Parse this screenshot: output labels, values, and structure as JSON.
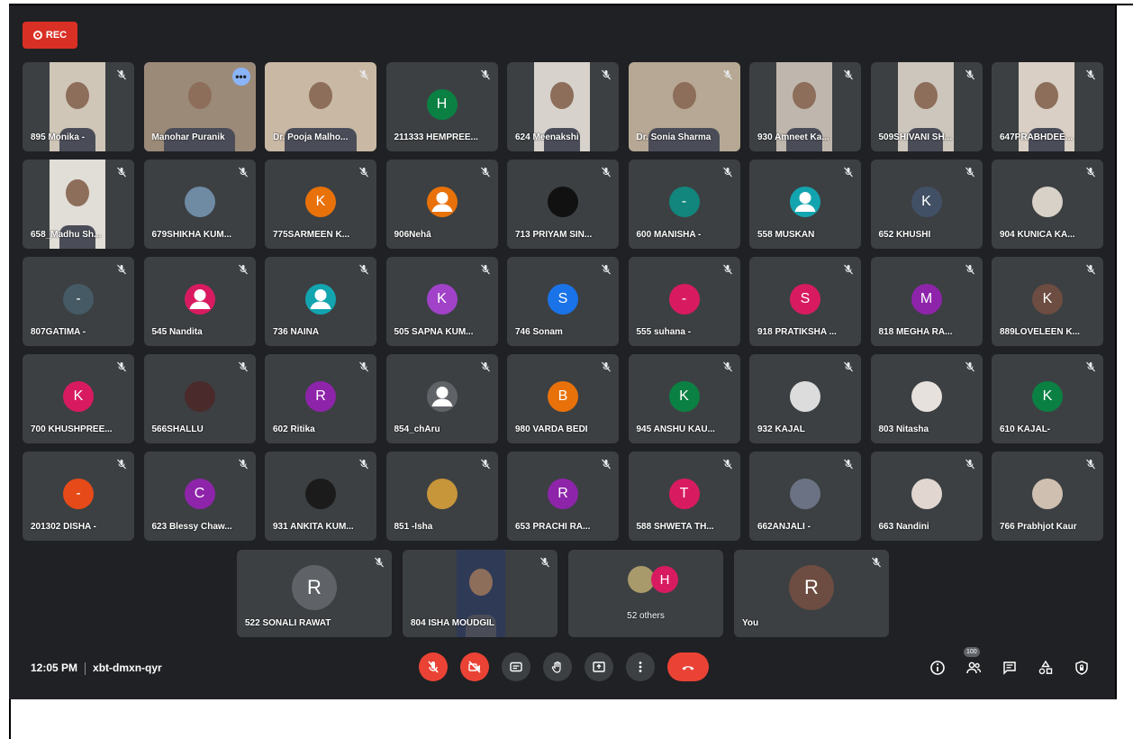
{
  "recording": {
    "label": "REC"
  },
  "participants": [
    {
      "name": "895 Monika -",
      "kind": "video",
      "bg": "#cfc6b8",
      "vx": 30,
      "vw": 62
    },
    {
      "name": "Manohar Puranik",
      "kind": "video",
      "bg": "#9c8a78",
      "vx": 0,
      "vw": 124,
      "active": true
    },
    {
      "name": "Dr. Pooja Malho...",
      "kind": "video",
      "bg": "#c9b8a4",
      "vx": 0,
      "vw": 124
    },
    {
      "name": "211333 HEMPREE...",
      "kind": "letter",
      "letter": "H",
      "color": "#0b8043"
    },
    {
      "name": "624 Meenakshi",
      "kind": "video",
      "bg": "#d7d2cc",
      "vx": 30,
      "vw": 62
    },
    {
      "name": "Dr. Sonia Sharma",
      "kind": "video",
      "bg": "#b6a894",
      "vx": 0,
      "vw": 124
    },
    {
      "name": "930 Amneet Ka...",
      "kind": "video",
      "bg": "#bfb7ad",
      "vx": 30,
      "vw": 62
    },
    {
      "name": "509SHIVANI SH...",
      "kind": "video",
      "bg": "#cdc6bc",
      "vx": 30,
      "vw": 62
    },
    {
      "name": "647PRABHDEE...",
      "kind": "video",
      "bg": "#d9cfc4",
      "vx": 30,
      "vw": 62
    },
    {
      "name": "658_Madhu Sh...",
      "kind": "video",
      "bg": "#e1ddd7",
      "vx": 30,
      "vw": 62
    },
    {
      "name": "679SHIKHA KUM...",
      "kind": "photo",
      "color": "#6f8aa3"
    },
    {
      "name": "775SARMEEN K...",
      "kind": "letter",
      "letter": "K",
      "color": "#e8710a"
    },
    {
      "name": "906Nehā",
      "kind": "person",
      "color": "#e8710a"
    },
    {
      "name": "713 PRIYAM SIN...",
      "kind": "photo",
      "color": "#111111"
    },
    {
      "name": "600 MANISHA -",
      "kind": "letter",
      "letter": "-",
      "color": "#12857c"
    },
    {
      "name": "558 MUSKAN",
      "kind": "person",
      "color": "#12a4af"
    },
    {
      "name": "652 KHUSHI",
      "kind": "letter",
      "letter": "K",
      "color": "#425066"
    },
    {
      "name": "904 KUNICA KA...",
      "kind": "photo",
      "color": "#d8d1c8"
    },
    {
      "name": "807GATIMA -",
      "kind": "letter",
      "letter": "-",
      "color": "#455a64"
    },
    {
      "name": "545 Nandita",
      "kind": "person",
      "color": "#d81b60"
    },
    {
      "name": "736 NAINA",
      "kind": "person",
      "color": "#12a4af"
    },
    {
      "name": "505 SAPNA KUM...",
      "kind": "letter",
      "letter": "K",
      "color": "#a142c8"
    },
    {
      "name": "746 Sonam",
      "kind": "letter",
      "letter": "S",
      "color": "#1a73e8"
    },
    {
      "name": "555 suhana -",
      "kind": "letter",
      "letter": "-",
      "color": "#d81b60"
    },
    {
      "name": "918 PRATIKSHA ...",
      "kind": "letter",
      "letter": "S",
      "color": "#d81b60"
    },
    {
      "name": "818 MEGHA RA...",
      "kind": "letter",
      "letter": "M",
      "color": "#8e24aa"
    },
    {
      "name": "889LOVELEEN K...",
      "kind": "letter",
      "letter": "K",
      "color": "#6d4c41"
    },
    {
      "name": "700 KHUSHPREE...",
      "kind": "letter",
      "letter": "K",
      "color": "#d81b60"
    },
    {
      "name": "566SHALLU",
      "kind": "photo",
      "color": "#4a2a2a"
    },
    {
      "name": "602 Ritika",
      "kind": "letter",
      "letter": "R",
      "color": "#8e24aa"
    },
    {
      "name": "854_chAru",
      "kind": "person",
      "color": "#5f6368"
    },
    {
      "name": "980 VARDA BEDI",
      "kind": "letter",
      "letter": "B",
      "color": "#e8710a"
    },
    {
      "name": "945 ANSHU KAU...",
      "kind": "letter",
      "letter": "K",
      "color": "#0b8043"
    },
    {
      "name": "932 KAJAL",
      "kind": "photo",
      "color": "#dcdcdc"
    },
    {
      "name": "803 Nitasha",
      "kind": "photo",
      "color": "#e6e1dc"
    },
    {
      "name": "610 KAJAL-",
      "kind": "letter",
      "letter": "K",
      "color": "#0b8043"
    },
    {
      "name": "201302 DISHA -",
      "kind": "letter",
      "letter": "-",
      "color": "#e64a19"
    },
    {
      "name": "623 Blessy Chaw...",
      "kind": "letter",
      "letter": "C",
      "color": "#8e24aa"
    },
    {
      "name": "931 ANKITA KUM...",
      "kind": "photo",
      "color": "#1b1b1b"
    },
    {
      "name": "851 -Isha",
      "kind": "photo",
      "color": "#c7953a"
    },
    {
      "name": "653 PRACHI RA...",
      "kind": "letter",
      "letter": "R",
      "color": "#8e24aa"
    },
    {
      "name": "588 SHWETA TH...",
      "kind": "letter",
      "letter": "T",
      "color": "#d81b60"
    },
    {
      "name": "662ANJALI -",
      "kind": "photo",
      "color": "#6a7284"
    },
    {
      "name": "663 Nandini",
      "kind": "photo",
      "color": "#e1d6d0"
    },
    {
      "name": "766 Prabhjot Kaur",
      "kind": "photo",
      "color": "#cfbfb0"
    }
  ],
  "bottom_row": [
    {
      "name": "522 SONALI RAWAT",
      "kind": "letter",
      "letter": "R",
      "color": "#5f6368"
    },
    {
      "name": "804 ISHA MOUDGIL",
      "kind": "video",
      "bg": "#2f3a57"
    },
    {
      "name": "52 others",
      "kind": "others",
      "letter": "H"
    },
    {
      "name": "You",
      "kind": "letter",
      "letter": "R",
      "color": "#6d4c41"
    }
  ],
  "bottom_bar": {
    "time": "12:05 PM",
    "meeting_code": "xbt-dmxn-qyr",
    "participants_badge": "100"
  },
  "colors": {
    "background": "#202124",
    "tile": "#3c4043",
    "danger": "#ea4335",
    "accent": "#8ab4f8"
  }
}
